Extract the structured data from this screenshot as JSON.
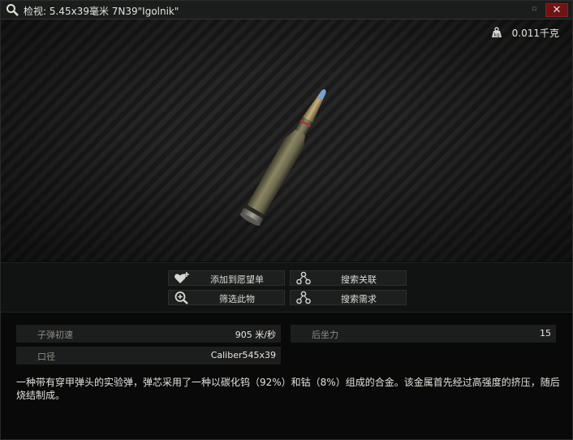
{
  "window": {
    "title": "检视: 5.45x39毫米 7N39\"Igolnik\"",
    "minimize_glyph": "▫",
    "close_glyph": "✕"
  },
  "preview": {
    "weight": "0.011千克",
    "weight_icon": "weight-icon"
  },
  "actions": {
    "add_wishlist": "添加到愿望单",
    "search_related": "搜索关联",
    "filter_item": "筛选此物",
    "search_requirements": "搜索需求"
  },
  "stats": {
    "velocity_label": "子弹初速",
    "velocity_value": "905 米/秒",
    "recoil_label": "后坐力",
    "recoil_value": "15",
    "caliber_label": "口径",
    "caliber_value": "Caliber545x39"
  },
  "description": "一种带有穿甲弹头的实验弹，弹芯采用了一种以碳化钨（92%）和钴（8%）组成的合金。该金属首先经过高强度的挤压，随后烧结制成。",
  "colors": {
    "close_button": "#6e1414",
    "bullet_tip": "#7da1c9",
    "cartridge_case": "#6d6a4f"
  }
}
